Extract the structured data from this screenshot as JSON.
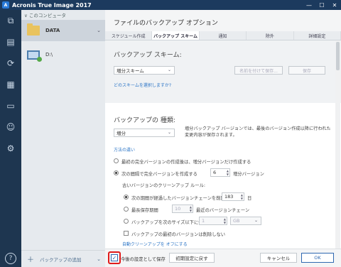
{
  "app": {
    "title": "Acronis True Image 2017",
    "logo_letter": "A"
  },
  "window_controls": {
    "minimize": "—",
    "maximize": "☐",
    "close": "✕"
  },
  "nav": {
    "items": [
      "backup-icon",
      "archive-icon",
      "sync-icon",
      "dashboard-icon",
      "devices-icon",
      "account-icon",
      "settings-icon"
    ],
    "help_label": "?"
  },
  "sidebar": {
    "header": "∨ このコンピュータ",
    "source": {
      "label": "DATA"
    },
    "destination": {
      "label": "D:\\"
    },
    "add_backup": {
      "label": "バックアップの追加"
    }
  },
  "panel": {
    "title": "ファイルのバックアップ オプション",
    "tabs": [
      "スケジュール作成",
      "バックアップ スキーム",
      "通知",
      "除外",
      "詳細設定"
    ],
    "active_tab": 1,
    "scheme": {
      "heading": "バックアップ スキーム:",
      "selected": "増分スキーム",
      "save_as_label": "名前を付けて保存...",
      "delete_label": "保存",
      "choose_link": "どのスキームを選択しますか?"
    },
    "method": {
      "heading": "バックアップの 種類:",
      "selected": "増分",
      "description": "増分バックアップ バージョンでは、最後のバージョン作成以降に行われた変更内容が保存されます。",
      "howto_link": "方法の違い",
      "options": [
        {
          "label": "最初の完全バージョンの作成後は、増分バージョンだけ作成する",
          "selected": false
        },
        {
          "label": "次の間隔で完全バージョンを作成する",
          "selected": true,
          "value": "6",
          "suffix": "増分バージョン"
        }
      ]
    },
    "cleanup": {
      "heading": "古いバージョンのクリーンアップ ルール:",
      "rules": [
        {
          "label": "次の期間が経過したバージョンチェーンを削除する",
          "selected": true,
          "value": "183",
          "unit": "日"
        },
        {
          "label": "最長保存期間",
          "selected": false,
          "value": "10",
          "suffix": "最近のバージョンチェーン"
        },
        {
          "label": "バックアップを次のサイズ以下に保つ",
          "selected": false,
          "value": "1",
          "unit": "GB"
        }
      ],
      "keep_first_label": "バックアップの最初のバージョンは削除しない",
      "auto_cleanup_link": "自動クリーンアップを オフにする"
    }
  },
  "footer": {
    "default_label": "今後の設定として保存",
    "reset_label": "初期設定に戻す",
    "cancel_label": "キャンセル",
    "ok_label": "OK"
  },
  "colors": {
    "nav_bg": "#1e3650",
    "accent": "#2f68b0",
    "link": "#2a74c6",
    "highlight": "#e01b1b"
  }
}
